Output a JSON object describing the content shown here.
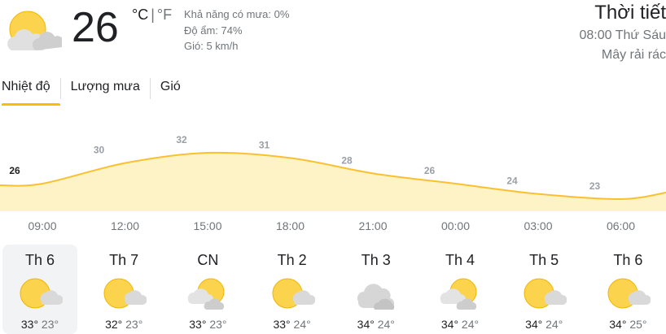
{
  "current": {
    "icon": "partly-cloudy-icon",
    "temperature": "26",
    "unit_c": "°C",
    "unit_sep": "|",
    "unit_f": "°F",
    "precip": "Khả năng có mưa: 0%",
    "humidity": "Độ ẩm: 74%",
    "wind": "Gió: 5 km/h"
  },
  "header": {
    "title": "Thời tiết",
    "datetime": "08:00 Thứ Sáu",
    "condition": "Mây rải rác"
  },
  "tabs": [
    {
      "label": "Nhiệt độ",
      "active": true
    },
    {
      "label": "Lượng mưa",
      "active": false
    },
    {
      "label": "Gió",
      "active": false
    }
  ],
  "chart_data": {
    "type": "area",
    "labels": [
      "26",
      "30",
      "32",
      "31",
      "28",
      "26",
      "24",
      "23"
    ],
    "values": [
      26,
      30,
      32,
      31,
      28,
      26,
      24,
      23
    ],
    "x_labels": [
      "09:00",
      "12:00",
      "15:00",
      "18:00",
      "21:00",
      "00:00",
      "03:00",
      "06:00"
    ],
    "line_color": "#fbc02d",
    "fill_color": "#fdf3c7"
  },
  "days": [
    {
      "name": "Th 6",
      "icon": "sun-cloud-icon",
      "high": "33°",
      "low": "23°",
      "selected": true
    },
    {
      "name": "Th 7",
      "icon": "sun-cloud-icon",
      "high": "32°",
      "low": "23°",
      "selected": false
    },
    {
      "name": "CN",
      "icon": "cloud-sun-icon",
      "high": "33°",
      "low": "23°",
      "selected": false
    },
    {
      "name": "Th 2",
      "icon": "sun-cloud-icon",
      "high": "33°",
      "low": "24°",
      "selected": false
    },
    {
      "name": "Th 3",
      "icon": "cloudy-icon",
      "high": "34°",
      "low": "24°",
      "selected": false
    },
    {
      "name": "Th 4",
      "icon": "cloud-sun-icon",
      "high": "34°",
      "low": "24°",
      "selected": false
    },
    {
      "name": "Th 5",
      "icon": "sun-cloud-icon",
      "high": "34°",
      "low": "24°",
      "selected": false
    },
    {
      "name": "Th 6",
      "icon": "sun-cloud-icon",
      "high": "34°",
      "low": "25°",
      "selected": false
    }
  ]
}
